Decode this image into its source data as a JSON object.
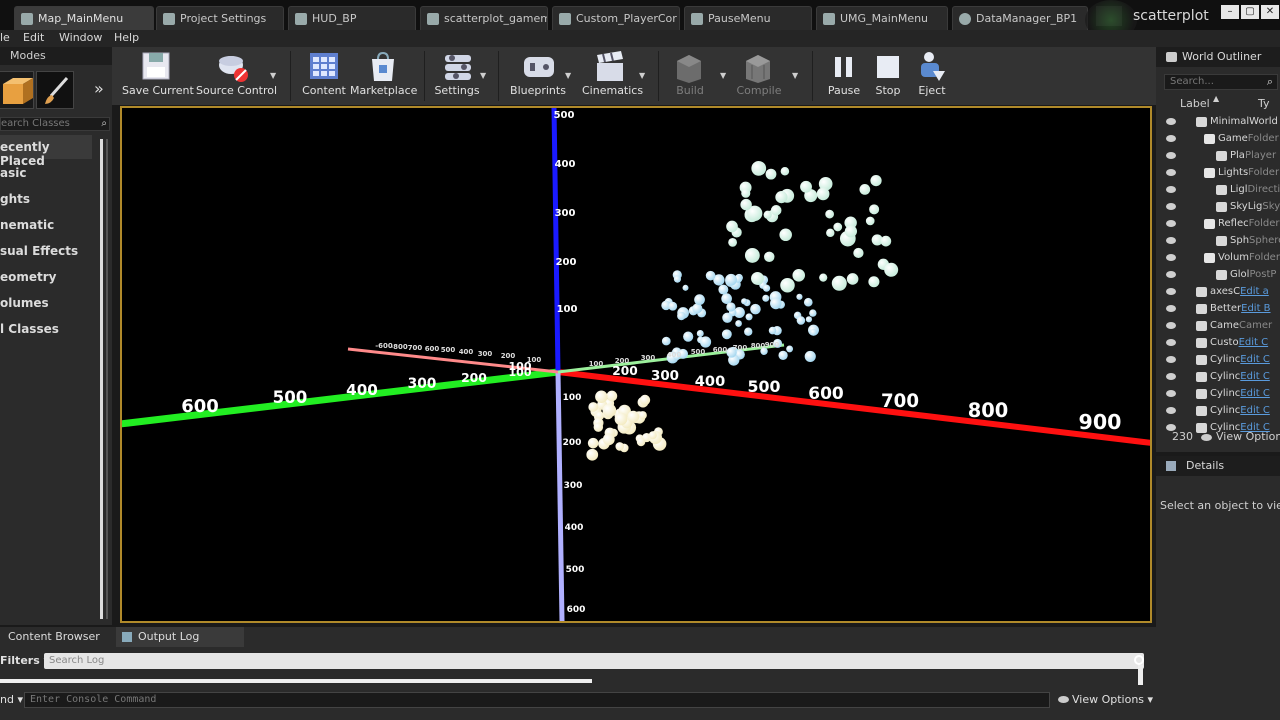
{
  "tabs": [
    {
      "label": "Map_MainMenu",
      "active": true
    },
    {
      "label": "Project Settings"
    },
    {
      "label": "HUD_BP"
    },
    {
      "label": "scatterplot_gamem"
    },
    {
      "label": "Custom_PlayerCor"
    },
    {
      "label": "PauseMenu"
    },
    {
      "label": "UMG_MainMenu"
    },
    {
      "label": "DataManager_BP1"
    }
  ],
  "window_title": "scatterplot",
  "menu": [
    "le",
    "Edit",
    "Window",
    "Help"
  ],
  "modes": {
    "title": "Modes",
    "search_placeholder": "earch Classes",
    "categories": [
      "ecently Placed",
      "asic",
      "ghts",
      "nematic",
      "sual Effects",
      "eometry",
      "olumes",
      "l Classes"
    ]
  },
  "toolbar": {
    "buttons": [
      {
        "label": "Save Current",
        "icon": "save-icon"
      },
      {
        "label": "Source Control",
        "icon": "source-control-icon"
      },
      {
        "label": "Content",
        "icon": "content-icon"
      },
      {
        "label": "Marketplace",
        "icon": "marketplace-icon"
      },
      {
        "label": "Settings",
        "icon": "settings-icon"
      },
      {
        "label": "Blueprints",
        "icon": "blueprints-icon"
      },
      {
        "label": "Cinematics",
        "icon": "cinematics-icon"
      },
      {
        "label": "Build",
        "icon": "build-icon",
        "disabled": true
      },
      {
        "label": "Compile",
        "icon": "compile-icon",
        "disabled": true
      },
      {
        "label": "Pause",
        "icon": "pause-icon"
      },
      {
        "label": "Stop",
        "icon": "stop-icon"
      },
      {
        "label": "Eject",
        "icon": "eject-icon"
      }
    ]
  },
  "viewport": {
    "axis_colors": {
      "x": "#ff1010",
      "y": "#22ee22",
      "z": "#1a1aff",
      "neg_x": "#ff8a8a",
      "neg_y": "#9cf09c",
      "neg_z": "#b0b0ff"
    },
    "x_axis_labels": [
      "100",
      "200",
      "300",
      "400",
      "500",
      "600",
      "700",
      "800",
      "900"
    ],
    "y_axis_labels": [
      "100",
      "200",
      "300",
      "400",
      "500",
      "600"
    ],
    "z_axis_labels": [
      "500",
      "400",
      "300",
      "200",
      "100"
    ],
    "neg_z_labels": [
      "100",
      "200",
      "300",
      "400",
      "500",
      "600"
    ],
    "neg_x_labels": [
      "-600",
      "-800",
      "700",
      "600",
      "500",
      "400",
      "300",
      "200",
      "100"
    ],
    "neg_y_labels": [
      "100",
      "200",
      "300",
      "400",
      "500",
      "600",
      "700",
      "800",
      "900"
    ],
    "cluster_colors": {
      "blue": "#a8d8f0",
      "teal": "#c8ecdc",
      "cream": "#f4ecc4"
    }
  },
  "outliner": {
    "title": "World Outliner",
    "search_placeholder": "Search...",
    "col_label": "Label",
    "col_type": "Ty",
    "rows": [
      {
        "name": "MinimalWorld",
        "type": ""
      },
      {
        "name": "Game",
        "type": "Folder"
      },
      {
        "name": "Pla",
        "type": "Player"
      },
      {
        "name": "Lights",
        "type": "Folder"
      },
      {
        "name": "Ligl",
        "type": "Directi"
      },
      {
        "name": "SkyLig",
        "type": "SkyLig"
      },
      {
        "name": "Reflec",
        "type": "Folder"
      },
      {
        "name": "Sph",
        "type": "Sphere"
      },
      {
        "name": "Volum",
        "type": "Folder"
      },
      {
        "name": "Glol",
        "type": "PostP"
      },
      {
        "name": "axesC",
        "type": "Edit a"
      },
      {
        "name": "Better",
        "type": "Edit B"
      },
      {
        "name": "Came",
        "type": "Camer"
      },
      {
        "name": "Custo",
        "type": "Edit C"
      },
      {
        "name": "Cylinc",
        "type": "Edit C"
      },
      {
        "name": "Cylinc",
        "type": "Edit C"
      },
      {
        "name": "Cylinc",
        "type": "Edit C"
      },
      {
        "name": "Cylinc",
        "type": "Edit C"
      },
      {
        "name": "Cylinc",
        "type": "Edit C"
      }
    ],
    "count": "230",
    "view_options": "View Options"
  },
  "details": {
    "title": "Details",
    "message": "Select an object to view d"
  },
  "bottom": {
    "tabs": [
      "Content Browser",
      "Output Log"
    ],
    "filters": "Filters",
    "search_placeholder": "Search Log",
    "cmd_label": "nd",
    "console_placeholder": "Enter Console Command",
    "view_options": "View Options"
  }
}
